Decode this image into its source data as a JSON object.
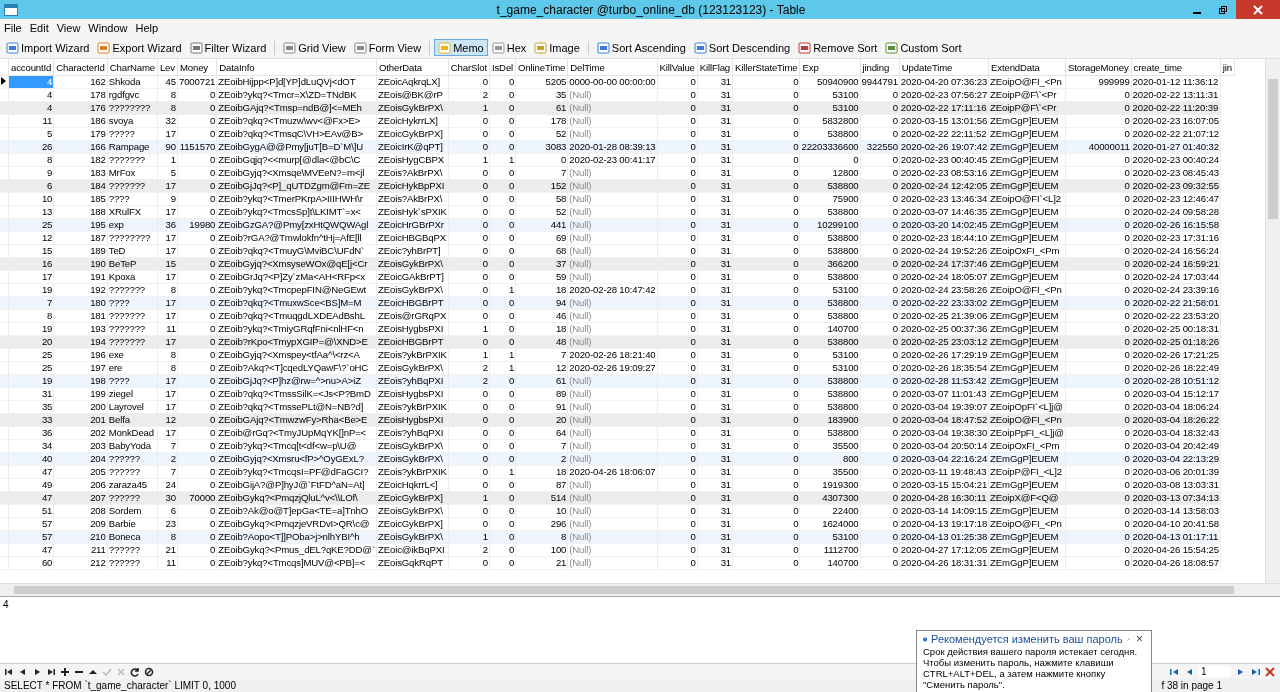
{
  "window": {
    "title": "t_game_character @turbo_online_db (123123123) - Table"
  },
  "menu": [
    "File",
    "Edit",
    "View",
    "Window",
    "Help"
  ],
  "toolbar": [
    [
      {
        "label": "Import Wizard",
        "selected": false
      },
      {
        "label": "Export Wizard",
        "selected": false
      },
      {
        "label": "Filter Wizard",
        "selected": false
      }
    ],
    [
      {
        "label": "Grid View",
        "selected": false
      },
      {
        "label": "Form View",
        "selected": false
      }
    ],
    [
      {
        "label": "Memo",
        "selected": true
      },
      {
        "label": "Hex",
        "selected": false
      },
      {
        "label": "Image",
        "selected": false
      }
    ],
    [
      {
        "label": "Sort Ascending",
        "selected": false
      },
      {
        "label": "Sort Descending",
        "selected": false
      },
      {
        "label": "Remove Sort",
        "selected": false
      },
      {
        "label": "Custom Sort",
        "selected": false
      }
    ]
  ],
  "table": {
    "columns": [
      {
        "name": "accountId",
        "kind": "number"
      },
      {
        "name": "CharacterId",
        "kind": "number"
      },
      {
        "name": "CharName",
        "kind": "string"
      },
      {
        "name": "Lev",
        "kind": "number"
      },
      {
        "name": "Money",
        "kind": "number"
      },
      {
        "name": "DataInfo",
        "kind": "string"
      },
      {
        "name": "OtherData",
        "kind": "string"
      },
      {
        "name": "CharSlot",
        "kind": "number"
      },
      {
        "name": "IsDel",
        "kind": "number"
      },
      {
        "name": "OnlineTime",
        "kind": "number"
      },
      {
        "name": "DelTime",
        "kind": "string"
      },
      {
        "name": "KillValue",
        "kind": "number"
      },
      {
        "name": "KillFlag",
        "kind": "number"
      },
      {
        "name": "KillerStateTime",
        "kind": "number"
      },
      {
        "name": "Exp",
        "kind": "number"
      },
      {
        "name": "jinding",
        "kind": "number"
      },
      {
        "name": "UpdateTime",
        "kind": "string"
      },
      {
        "name": "ExtendData",
        "kind": "string"
      },
      {
        "name": "StorageMoney",
        "kind": "number"
      },
      {
        "name": "create_time",
        "kind": "string"
      },
      {
        "name": "jin"
      }
    ],
    "rows": [
      {
        "selected": true,
        "cells": [
          "4",
          "162",
          "Shkoda",
          "45",
          "7000721",
          "ZEoibHijpp<P]d[YP]dLuQVj<dOT",
          "ZEoicAqkrqLX]",
          "0",
          "0",
          "5205",
          "0000-00-00 00:00:00",
          "0",
          "31",
          "0",
          "50940900",
          "9944791",
          "2020-04-20 07:36:23",
          "ZEoipO@FI_<Pn",
          "999999",
          "2020-01-12 11:36:12"
        ]
      },
      {
        "selected": false,
        "cells": [
          "4",
          "178",
          "rgdfgvc",
          "8",
          "0",
          "ZEoib?ykq?<Tmcr=X\\ZD=TNdBK",
          "ZEois@BK@rP",
          "2",
          "0",
          "35",
          {
            "text": "(Null)",
            "null": true
          },
          "0",
          "31",
          "0",
          "53100",
          "0",
          "2020-02-23 07:56:27",
          "ZEoipP@F\\`<Pr",
          "0",
          "2020-02-22 13:11:31"
        ]
      },
      {
        "selected": false,
        "cells": [
          "4",
          "176",
          "????????",
          "8",
          "0",
          "ZEoibGAjq?<Tmsp=ndB@]<=MEh",
          "ZEoisGykBrPX\\",
          "1",
          "0",
          "61",
          {
            "text": "(Null)",
            "null": true
          },
          "0",
          "31",
          "0",
          "53100",
          "0",
          "2020-02-22 17:11:16",
          "ZEoipP@F\\`<Pr",
          "0",
          "2020-02-22 11:20:39"
        ]
      },
      {
        "selected": false,
        "cells": [
          "11",
          "186",
          "svoya",
          "32",
          "0",
          "ZEoib?qkq?<Tmuzw\\wv<@Fx>E>",
          "ZEoicHykrrLX]",
          "0",
          "0",
          "178",
          {
            "text": "(Null)",
            "null": true
          },
          "0",
          "31",
          "0",
          "5832800",
          "0",
          "2020-03-15 13:01:56",
          "ZEmGgP]EUEM",
          "0",
          "2020-02-23 16:07:05"
        ]
      },
      {
        "selected": false,
        "cells": [
          "5",
          "179",
          "?????",
          "17",
          "0",
          "ZEoib?qkq?<TmsqC\\VH>EAv@B>",
          "ZEoicGykBrPX]",
          "0",
          "0",
          "52",
          {
            "text": "(Null)",
            "null": true
          },
          "0",
          "31",
          "0",
          "538800",
          "0",
          "2020-02-22 22:11:52",
          "ZEmGgP]EUEM",
          "0",
          "2020-02-22 21:07:12"
        ]
      },
      {
        "selected": false,
        "cells": [
          "26",
          "166",
          "Rampage",
          "90",
          "1151570",
          "ZEoibGygA@@Pmy[juT[B=D`M\\]U",
          "ZEoicIrK@qPT]",
          "0",
          "0",
          "3083",
          "2020-01-28 08:39:13",
          "0",
          "31",
          "0",
          "22203336600",
          "322550",
          "2020-02-26 19:07:42",
          "ZEmGgP]EUEM",
          "40000011",
          "2020-01-27 01:40:32"
        ]
      },
      {
        "selected": false,
        "cells": [
          "8",
          "182",
          "???????",
          "1",
          "0",
          "ZEoibGqjq?<<murp[@dla<@bC\\C",
          "ZEoisHygCBPX",
          "1",
          "1",
          "0",
          "2020-02-23 00:41:17",
          "0",
          "31",
          "0",
          "0",
          "0",
          "2020-02-23 00:40:45",
          "ZEmGgP]EUEM",
          "0",
          "2020-02-23 00:40:24"
        ]
      },
      {
        "selected": false,
        "cells": [
          "9",
          "183",
          "MrFox",
          "5",
          "0",
          "ZEoibGyjq?<Xmsqe\\MVEeN?=m<jl",
          "ZEois?AkBrPX\\",
          "0",
          "0",
          "7",
          {
            "text": "(Null)",
            "null": true
          },
          "0",
          "31",
          "0",
          "12800",
          "0",
          "2020-02-23 08:53:16",
          "ZEmGgP]EUEM",
          "0",
          "2020-02-23 08:45:43"
        ]
      },
      {
        "selected": false,
        "cells": [
          "6",
          "184",
          "???????",
          "17",
          "0",
          "ZEoibGjJq?<P]_qUTDZgm@Fm=ZE",
          "ZEoicHykBpPXI",
          "0",
          "0",
          "152",
          {
            "text": "(Null)",
            "null": true
          },
          "0",
          "31",
          "0",
          "538800",
          "0",
          "2020-02-24 12:42:05",
          "ZEmGgP]EUEM",
          "0",
          "2020-02-23 09:32:55"
        ]
      },
      {
        "selected": false,
        "cells": [
          "10",
          "185",
          "????",
          "9",
          "0",
          "ZEoib?ykq?<TmerPKrpA>IIIHWH\\r",
          "ZEois?AkBrPX\\",
          "0",
          "0",
          "58",
          {
            "text": "(Null)",
            "null": true
          },
          "0",
          "31",
          "0",
          "75900",
          "0",
          "2020-02-23 13:46:34",
          "ZEoipO@FI`<L]2",
          "0",
          "2020-02-23 12:46:47"
        ]
      },
      {
        "selected": false,
        "cells": [
          "13",
          "188",
          "XRulFX",
          "17",
          "0",
          "ZEoib?ykq?<TmcsSp]t\\LKIMT`=x<",
          "ZEoisHyk`sPXIK",
          "0",
          "0",
          "52",
          {
            "text": "(Null)",
            "null": true
          },
          "0",
          "31",
          "0",
          "538800",
          "0",
          "2020-03-07 14:46:35",
          "ZEmGgP]EUEM",
          "0",
          "2020-02-24 09:58:28"
        ]
      },
      {
        "selected": false,
        "cells": [
          "25",
          "195",
          "exp",
          "36",
          "19980",
          "ZEoibGzGA?@Pmy[zxHtQWQWAgl",
          "ZEoicHrGBrPXr",
          "0",
          "0",
          "441",
          {
            "text": "(Null)",
            "null": true
          },
          "0",
          "31",
          "0",
          "10299100",
          "0",
          "2020-03-20 14:02:45",
          "ZEmGgP]EUEM",
          "0",
          "2020-02-26 16:15:58"
        ]
      },
      {
        "selected": false,
        "cells": [
          "12",
          "187",
          "????????",
          "17",
          "0",
          "ZEoib?rGA?@Tmwlokfn^tHj=AfE[ll",
          "ZEoicHBGBqPX",
          "0",
          "0",
          "69",
          {
            "text": "(Null)",
            "null": true
          },
          "0",
          "31",
          "0",
          "538800",
          "0",
          "2020-02-23 18:44:10",
          "ZEmGgP]EUEM",
          "0",
          "2020-02-23 17:31:16"
        ]
      },
      {
        "selected": false,
        "cells": [
          "15",
          "189",
          "TeD",
          "17",
          "0",
          "ZEoib?qkq?<TmuyG\\MviBC\\UFdN`",
          "ZEoic?yhBrPT]",
          "0",
          "0",
          "68",
          {
            "text": "(Null)",
            "null": true
          },
          "0",
          "31",
          "0",
          "538800",
          "0",
          "2020-02-24 19:52:26",
          "ZEoipOxFI_<Pm",
          "0",
          "2020-02-24 16:56:24"
        ]
      },
      {
        "selected": false,
        "cells": [
          "16",
          "190",
          "BeTeP",
          "15",
          "0",
          "ZEoibGyjq?<XmsyseWOx@qE[j<Cr",
          "ZEoisGykBrPX\\",
          "0",
          "0",
          "37",
          {
            "text": "(Null)",
            "null": true
          },
          "0",
          "31",
          "0",
          "366200",
          "0",
          "2020-02-24 17:37:46",
          "ZEmGgP]EUEM",
          "0",
          "2020-02-24 16:59:21"
        ]
      },
      {
        "selected": false,
        "cells": [
          "17",
          "191",
          "Kpoxa",
          "17",
          "0",
          "ZEoibGrJq?<P]Zy`zMa<AH<RFp<x",
          "ZEoicGAkBrPT]",
          "0",
          "0",
          "59",
          {
            "text": "(Null)",
            "null": true
          },
          "0",
          "31",
          "0",
          "538800",
          "0",
          "2020-02-24 18:05:07",
          "ZEmGgP]EUEM",
          "0",
          "2020-02-24 17:03:44"
        ]
      },
      {
        "selected": false,
        "cells": [
          "19",
          "192",
          "???????",
          "8",
          "0",
          "ZEoib?ykq?<TmcpepFIN@NeGEwt",
          "ZEoisGykBrPX\\",
          "0",
          "1",
          "18",
          "2020-02-28 10:47:42",
          "0",
          "31",
          "0",
          "53100",
          "0",
          "2020-02-24 23:58:26",
          "ZEoipO@FI_<Pn",
          "0",
          "2020-02-24 23:39:16"
        ]
      },
      {
        "selected": false,
        "cells": [
          "7",
          "180",
          "????",
          "17",
          "0",
          "ZEoib?qkq?<TmuxwSce<BS]M=M",
          "ZEoicHBGBrPT",
          "0",
          "0",
          "94",
          {
            "text": "(Null)",
            "null": true
          },
          "0",
          "31",
          "0",
          "538800",
          "0",
          "2020-02-22 23:33:02",
          "ZEmGgP]EUEM",
          "0",
          "2020-02-22 21:58:01"
        ]
      },
      {
        "selected": false,
        "cells": [
          "8",
          "181",
          "???????",
          "17",
          "0",
          "ZEoib?qkq?<TmuqgdLXDEAdBshL",
          "ZEois@rGRqPX",
          "0",
          "0",
          "46",
          {
            "text": "(Null)",
            "null": true
          },
          "0",
          "31",
          "0",
          "538800",
          "0",
          "2020-02-25 21:39:06",
          "ZEmGgP]EUEM",
          "0",
          "2020-02-22 23:53:20"
        ]
      },
      {
        "selected": false,
        "cells": [
          "19",
          "193",
          "???????",
          "11",
          "0",
          "ZEoib?ykq?<TmiyGRqfFni<nlHF<n",
          "ZEoisHygbsPXI",
          "1",
          "0",
          "18",
          {
            "text": "(Null)",
            "null": true
          },
          "0",
          "31",
          "0",
          "140700",
          "0",
          "2020-02-25 00:37:36",
          "ZEmGgP]EUEM",
          "0",
          "2020-02-25 00:18:31"
        ]
      },
      {
        "selected": false,
        "cells": [
          "20",
          "194",
          "???????",
          "17",
          "0",
          "ZEoib?rKpo<TmypXGIP=@\\XND>E",
          "ZEoicHBGBrPT",
          "0",
          "0",
          "48",
          {
            "text": "(Null)",
            "null": true
          },
          "0",
          "31",
          "0",
          "538800",
          "0",
          "2020-02-25 23:03:12",
          "ZEmGgP]EUEM",
          "0",
          "2020-02-25 01:18:26"
        ]
      },
      {
        "selected": false,
        "cells": [
          "25",
          "196",
          "exe",
          "8",
          "0",
          "ZEoibGyjq?<Xmspey<tfAa^\\<rz<A",
          "ZEois?ykBrPXIK",
          "1",
          "1",
          "7",
          "2020-02-26 18:21:40",
          "0",
          "31",
          "0",
          "53100",
          "0",
          "2020-02-26 17:29:19",
          "ZEmGgP]EUEM",
          "0",
          "2020-02-26 17:21:25"
        ]
      },
      {
        "selected": false,
        "cells": [
          "25",
          "197",
          "ere",
          "8",
          "0",
          "ZEoib?Akq?<T]cqedLYQawF\\?`oHC",
          "ZEoisGykBrPX\\",
          "2",
          "1",
          "12",
          "2020-02-26 19:09:27",
          "0",
          "31",
          "0",
          "53100",
          "0",
          "2020-02-26 18:35:54",
          "ZEmGgP]EUEM",
          "0",
          "2020-02-26 18:22:49"
        ]
      },
      {
        "selected": false,
        "cells": [
          "19",
          "198",
          "????",
          "17",
          "0",
          "ZEoibGjJq?<P]hz@rw=^>nu>A>iZ",
          "ZEois?yhBqPXI",
          "2",
          "0",
          "61",
          {
            "text": "(Null)",
            "null": true
          },
          "0",
          "31",
          "0",
          "538800",
          "0",
          "2020-02-28 11:53:42",
          "ZEmGgP]EUEM",
          "0",
          "2020-02-28 10:51:12"
        ]
      },
      {
        "selected": false,
        "cells": [
          "31",
          "199",
          "ziegel",
          "17",
          "0",
          "ZEoib?qkq?<TmssSilK=<Js<P?BmD",
          "ZEoisHygbsPXI",
          "0",
          "0",
          "89",
          {
            "text": "(Null)",
            "null": true
          },
          "0",
          "31",
          "0",
          "538800",
          "0",
          "2020-03-07 11:01:43",
          "ZEmGgP]EUEM",
          "0",
          "2020-03-04 15:12:17"
        ]
      },
      {
        "selected": false,
        "cells": [
          "35",
          "200",
          "Layrovel",
          "17",
          "0",
          "ZEoib?qkq?<TmssePLt@N=NB?d]",
          "ZEois?ykBrPXIK",
          "0",
          "0",
          "91",
          {
            "text": "(Null)",
            "null": true
          },
          "0",
          "31",
          "0",
          "538800",
          "0",
          "2020-03-04 19:39:07",
          "ZEoipOpFI`<L]j@",
          "0",
          "2020-03-04 18:06:24"
        ]
      },
      {
        "selected": false,
        "cells": [
          "33",
          "201",
          "Belfa",
          "12",
          "0",
          "ZEoibGAjq?<TmwzwFy>Rha<Be>E",
          "ZEoisHygbsPXI",
          "0",
          "0",
          "20",
          {
            "text": "(Null)",
            "null": true
          },
          "0",
          "31",
          "0",
          "183900",
          "0",
          "2020-03-04 18:47:52",
          "ZEoipO@FI_<Pn",
          "0",
          "2020-03-04 18:26:22"
        ]
      },
      {
        "selected": false,
        "cells": [
          "36",
          "202",
          "MonkDead",
          "17",
          "0",
          "ZEoib@rGq?<TmyJUpMqYK[]nP=<",
          "ZEois?yhBqPXI",
          "0",
          "0",
          "64",
          {
            "text": "(Null)",
            "null": true
          },
          "0",
          "31",
          "0",
          "538800",
          "0",
          "2020-03-04 19:38:30",
          "ZEoipPpFI_<L]j@",
          "0",
          "2020-03-04 18:32:43"
        ]
      },
      {
        "selected": false,
        "cells": [
          "34",
          "203",
          "BabyYoda",
          "7",
          "0",
          "ZEoib?ykq?<Tmcq[t<df<w=p\\U@",
          "ZEoisGykBrPX\\",
          "0",
          "0",
          "7",
          {
            "text": "(Null)",
            "null": true
          },
          "0",
          "31",
          "0",
          "35500",
          "0",
          "2020-03-04 20:50:14",
          "ZEoipOxFI_<Pm",
          "0",
          "2020-03-04 20:42:49"
        ]
      },
      {
        "selected": false,
        "cells": [
          "40",
          "204",
          "??????",
          "2",
          "0",
          "ZEoibGyjq?<Xmsru<fP>^OyGExL?",
          "ZEoisGykBrPX\\",
          "0",
          "0",
          "2",
          {
            "text": "(Null)",
            "null": true
          },
          "0",
          "31",
          "0",
          "800",
          "0",
          "2020-03-04 22:16:24",
          "ZEmGgP]EUEM",
          "0",
          "2020-03-04 22:13:29"
        ]
      },
      {
        "selected": false,
        "cells": [
          "47",
          "205",
          "??????",
          "7",
          "0",
          "ZEoib?ykq?<TmcqsI=PF@dFaGCI?",
          "ZEois?ykBrPXIK",
          "0",
          "1",
          "18",
          "2020-04-26 18:06:07",
          "0",
          "31",
          "0",
          "35500",
          "0",
          "2020-03-11 19:48:43",
          "ZEoipP@FI_<L]2",
          "0",
          "2020-03-06 20:01:39"
        ]
      },
      {
        "selected": false,
        "cells": [
          "49",
          "206",
          "zaraza45",
          "24",
          "0",
          "ZEoibGijA?@P]hyJ@`FtFD^aN=At]",
          "ZEoicHqkrrL<]",
          "0",
          "0",
          "87",
          {
            "text": "(Null)",
            "null": true
          },
          "0",
          "31",
          "0",
          "1919300",
          "0",
          "2020-03-15 15:04:21",
          "ZEmGgP]EUEM",
          "0",
          "2020-03-08 13:03:31"
        ]
      },
      {
        "selected": false,
        "cells": [
          "47",
          "207",
          "??????",
          "30",
          "70000",
          "ZEoibGykq?<PmqzjQluL^v<\\\\LOf\\",
          "ZEoicGykBrPX]",
          "1",
          "0",
          "514",
          {
            "text": "(Null)",
            "null": true
          },
          "0",
          "31",
          "0",
          "4307300",
          "0",
          "2020-04-28 16:30:11",
          "ZEoipX@F<Q@",
          "0",
          "2020-03-13 07:34:13"
        ]
      },
      {
        "selected": false,
        "cells": [
          "51",
          "208",
          "Sordem",
          "6",
          "0",
          "ZEoib?Ak@o@T]epGa<TE=a]TnhO",
          "ZEoisGykBrPX\\",
          "0",
          "0",
          "10",
          {
            "text": "(Null)",
            "null": true
          },
          "0",
          "31",
          "0",
          "22400",
          "0",
          "2020-03-14 14:09:15",
          "ZEmGgP]EUEM",
          "0",
          "2020-03-14 13:58:03"
        ]
      },
      {
        "selected": false,
        "cells": [
          "57",
          "209",
          "Barbie",
          "23",
          "0",
          "ZEoibGykq?<PmqzjeVRDvI>QR\\c@",
          "ZEoicGykBrPX]",
          "0",
          "0",
          "296",
          {
            "text": "(Null)",
            "null": true
          },
          "0",
          "31",
          "0",
          "1624000",
          "0",
          "2020-04-13 19:17:18",
          "ZEoipO@FI_<Pn",
          "0",
          "2020-04-10 20:41:58"
        ]
      },
      {
        "selected": false,
        "cells": [
          "57",
          "210",
          "Boneca",
          "8",
          "0",
          "ZEoib?Aopo<T]]POba>j>nlhYBI^h",
          "ZEoisGykBrPX\\",
          "1",
          "0",
          "8",
          {
            "text": "(Null)",
            "null": true
          },
          "0",
          "31",
          "0",
          "53100",
          "0",
          "2020-04-13 01:25:38",
          "ZEmGgP]EUEM",
          "0",
          "2020-04-13 01:17:11"
        ]
      },
      {
        "selected": false,
        "cells": [
          "47",
          "211",
          "??????",
          "21",
          "0",
          "ZEoibGykq?<Pmus_dEL?qKE?DD@`",
          "ZEoic@ikBqPXI",
          "2",
          "0",
          "100",
          {
            "text": "(Null)",
            "null": true
          },
          "0",
          "31",
          "0",
          "1112700",
          "0",
          "2020-04-27 17:12:05",
          "ZEmGgP]EUEM",
          "0",
          "2020-04-26 15:54:25"
        ]
      },
      {
        "selected": false,
        "cells": [
          "60",
          "212",
          "??????",
          "11",
          "0",
          "ZEoib?ykq?<Tmcqs]MUV@<PB]=<",
          "ZEoisGqkRqPT",
          "0",
          "0",
          "21",
          {
            "text": "(Null)",
            "null": true
          },
          "0",
          "31",
          "0",
          "140700",
          "0",
          "2020-04-26 18:31:31",
          "ZEmGgP]EUEM",
          "0",
          "2020-04-26 18:08:57"
        ]
      }
    ]
  },
  "memo": {
    "value": "4"
  },
  "pager": {
    "page": "1"
  },
  "status_bar": {
    "query": "SELECT * FROM `t_game_character` LIMIT 0, 1000",
    "records": "f 38 in page 1"
  },
  "notification": {
    "title": "Рекомендуется изменить ваш пароль",
    "body": "Срок действия вашего пароля истекает сегодня. Чтобы изменить пароль, нажмите клавиши CTRL+ALT+DEL, а затем нажмите кнопку \"Сменить пароль\".",
    "close": "×"
  }
}
